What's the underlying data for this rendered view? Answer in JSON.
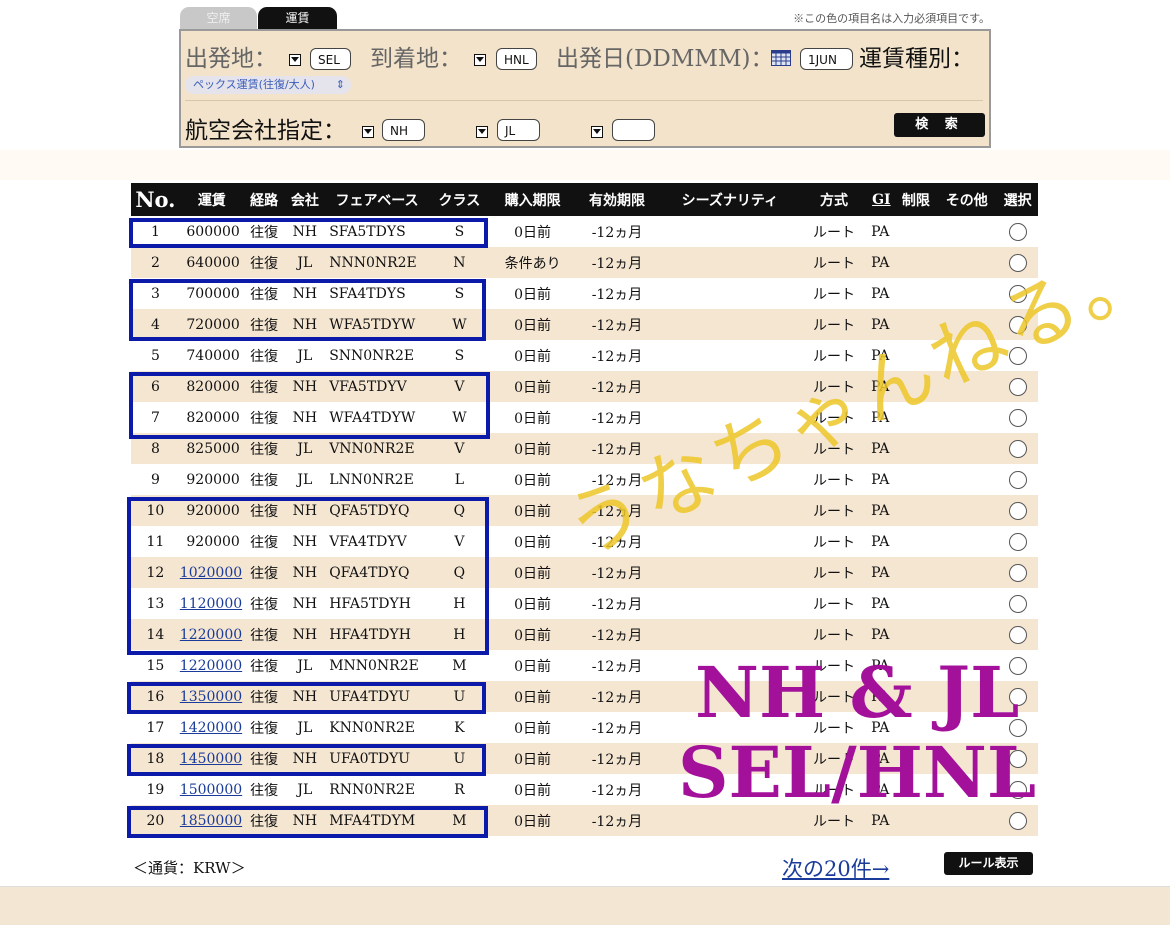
{
  "tabs": [
    {
      "label": "空席"
    },
    {
      "label": "運賃"
    }
  ],
  "required_note": "※この色の項目名は入力必須項目です。",
  "search": {
    "departure_label": "出発地：",
    "departure_value": "SEL",
    "arrival_label": "到着地：",
    "arrival_value": "HNL",
    "date_label": "出発日(DDMMM)：",
    "date_value": "1JUN",
    "fare_type_label": "運賃種別：",
    "fare_type_value": "ペックス運賃(往復/大人)",
    "airline_label": "航空会社指定：",
    "airline_values": [
      "NH",
      "JL",
      ""
    ],
    "search_button": "検 索"
  },
  "table": {
    "headers": [
      "No.",
      "運賃",
      "経路",
      "会社",
      "フェアベース",
      "クラス",
      "購入期限",
      "有効期限",
      "シーズナリティ",
      "方式",
      "GI",
      "制限",
      "その他",
      "選択"
    ],
    "rows": [
      {
        "no": "1",
        "fare": "600000",
        "route": "往復",
        "carrier": "NH",
        "basis": "SFA5TDYS",
        "cls": "S",
        "purchase": "0日前",
        "validity": "-12ヵ月",
        "season": "",
        "method": "ルート",
        "gi": "PA",
        "restrict": "",
        "other": "",
        "link": false
      },
      {
        "no": "2",
        "fare": "640000",
        "route": "往復",
        "carrier": "JL",
        "basis": "NNN0NR2E",
        "cls": "N",
        "purchase": "条件あり",
        "validity": "-12ヵ月",
        "season": "",
        "method": "ルート",
        "gi": "PA",
        "restrict": "",
        "other": "",
        "link": false
      },
      {
        "no": "3",
        "fare": "700000",
        "route": "往復",
        "carrier": "NH",
        "basis": "SFA4TDYS",
        "cls": "S",
        "purchase": "0日前",
        "validity": "-12ヵ月",
        "season": "",
        "method": "ルート",
        "gi": "PA",
        "restrict": "",
        "other": "",
        "link": false
      },
      {
        "no": "4",
        "fare": "720000",
        "route": "往復",
        "carrier": "NH",
        "basis": "WFA5TDYW",
        "cls": "W",
        "purchase": "0日前",
        "validity": "-12ヵ月",
        "season": "",
        "method": "ルート",
        "gi": "PA",
        "restrict": "",
        "other": "",
        "link": false
      },
      {
        "no": "5",
        "fare": "740000",
        "route": "往復",
        "carrier": "JL",
        "basis": "SNN0NR2E",
        "cls": "S",
        "purchase": "0日前",
        "validity": "-12ヵ月",
        "season": "",
        "method": "ルート",
        "gi": "PA",
        "restrict": "",
        "other": "",
        "link": false
      },
      {
        "no": "6",
        "fare": "820000",
        "route": "往復",
        "carrier": "NH",
        "basis": "VFA5TDYV",
        "cls": "V",
        "purchase": "0日前",
        "validity": "-12ヵ月",
        "season": "",
        "method": "ルート",
        "gi": "PA",
        "restrict": "",
        "other": "",
        "link": false
      },
      {
        "no": "7",
        "fare": "820000",
        "route": "往復",
        "carrier": "NH",
        "basis": "WFA4TDYW",
        "cls": "W",
        "purchase": "0日前",
        "validity": "-12ヵ月",
        "season": "",
        "method": "ルート",
        "gi": "PA",
        "restrict": "",
        "other": "",
        "link": false
      },
      {
        "no": "8",
        "fare": "825000",
        "route": "往復",
        "carrier": "JL",
        "basis": "VNN0NR2E",
        "cls": "V",
        "purchase": "0日前",
        "validity": "-12ヵ月",
        "season": "",
        "method": "ルート",
        "gi": "PA",
        "restrict": "",
        "other": "",
        "link": false
      },
      {
        "no": "9",
        "fare": "920000",
        "route": "往復",
        "carrier": "JL",
        "basis": "LNN0NR2E",
        "cls": "L",
        "purchase": "0日前",
        "validity": "-12ヵ月",
        "season": "",
        "method": "ルート",
        "gi": "PA",
        "restrict": "",
        "other": "",
        "link": false
      },
      {
        "no": "10",
        "fare": "920000",
        "route": "往復",
        "carrier": "NH",
        "basis": "QFA5TDYQ",
        "cls": "Q",
        "purchase": "0日前",
        "validity": "-12ヵ月",
        "season": "",
        "method": "ルート",
        "gi": "PA",
        "restrict": "",
        "other": "",
        "link": false
      },
      {
        "no": "11",
        "fare": "920000",
        "route": "往復",
        "carrier": "NH",
        "basis": "VFA4TDYV",
        "cls": "V",
        "purchase": "0日前",
        "validity": "-12ヵ月",
        "season": "",
        "method": "ルート",
        "gi": "PA",
        "restrict": "",
        "other": "",
        "link": false
      },
      {
        "no": "12",
        "fare": "1020000",
        "route": "往復",
        "carrier": "NH",
        "basis": "QFA4TDYQ",
        "cls": "Q",
        "purchase": "0日前",
        "validity": "-12ヵ月",
        "season": "",
        "method": "ルート",
        "gi": "PA",
        "restrict": "",
        "other": "",
        "link": true
      },
      {
        "no": "13",
        "fare": "1120000",
        "route": "往復",
        "carrier": "NH",
        "basis": "HFA5TDYH",
        "cls": "H",
        "purchase": "0日前",
        "validity": "-12ヵ月",
        "season": "",
        "method": "ルート",
        "gi": "PA",
        "restrict": "",
        "other": "",
        "link": true
      },
      {
        "no": "14",
        "fare": "1220000",
        "route": "往復",
        "carrier": "NH",
        "basis": "HFA4TDYH",
        "cls": "H",
        "purchase": "0日前",
        "validity": "-12ヵ月",
        "season": "",
        "method": "ルート",
        "gi": "PA",
        "restrict": "",
        "other": "",
        "link": true
      },
      {
        "no": "15",
        "fare": "1220000",
        "route": "往復",
        "carrier": "JL",
        "basis": "MNN0NR2E",
        "cls": "M",
        "purchase": "0日前",
        "validity": "-12ヵ月",
        "season": "",
        "method": "ルート",
        "gi": "PA",
        "restrict": "",
        "other": "",
        "link": true
      },
      {
        "no": "16",
        "fare": "1350000",
        "route": "往復",
        "carrier": "NH",
        "basis": "UFA4TDYU",
        "cls": "U",
        "purchase": "0日前",
        "validity": "-12ヵ月",
        "season": "",
        "method": "ルート",
        "gi": "PA",
        "restrict": "",
        "other": "",
        "link": true
      },
      {
        "no": "17",
        "fare": "1420000",
        "route": "往復",
        "carrier": "JL",
        "basis": "KNN0NR2E",
        "cls": "K",
        "purchase": "0日前",
        "validity": "-12ヵ月",
        "season": "",
        "method": "ルート",
        "gi": "PA",
        "restrict": "",
        "other": "",
        "link": true
      },
      {
        "no": "18",
        "fare": "1450000",
        "route": "往復",
        "carrier": "NH",
        "basis": "UFA0TDYU",
        "cls": "U",
        "purchase": "0日前",
        "validity": "-12ヵ月",
        "season": "",
        "method": "ルート",
        "gi": "PA",
        "restrict": "",
        "other": "",
        "link": true
      },
      {
        "no": "19",
        "fare": "1500000",
        "route": "往復",
        "carrier": "JL",
        "basis": "RNN0NR2E",
        "cls": "R",
        "purchase": "0日前",
        "validity": "-12ヵ月",
        "season": "",
        "method": "ルート",
        "gi": "PA",
        "restrict": "",
        "other": "",
        "link": true
      },
      {
        "no": "20",
        "fare": "1850000",
        "route": "往復",
        "carrier": "NH",
        "basis": "MFA4TDYM",
        "cls": "M",
        "purchase": "0日前",
        "validity": "-12ヵ月",
        "season": "",
        "method": "ルート",
        "gi": "PA",
        "restrict": "",
        "other": "",
        "link": true
      }
    ]
  },
  "footer": {
    "currency": "＜通貨：KRW＞",
    "next_link": "次の20件→",
    "rule_button": "ルール表示"
  },
  "overlays": {
    "highlight_color": "#0b1aa8",
    "highlighted_row_groups": [
      [
        1
      ],
      [
        3,
        4
      ],
      [
        6,
        7
      ],
      [
        10,
        11,
        12,
        13,
        14
      ],
      [
        16
      ],
      [
        18
      ],
      [
        20
      ]
    ],
    "title_line1": "NH & JL",
    "title_line2": "SEL/HNL",
    "signature": "うなちゃんねる。",
    "title_color": "#a3119b",
    "signature_color": "#ecc628"
  }
}
